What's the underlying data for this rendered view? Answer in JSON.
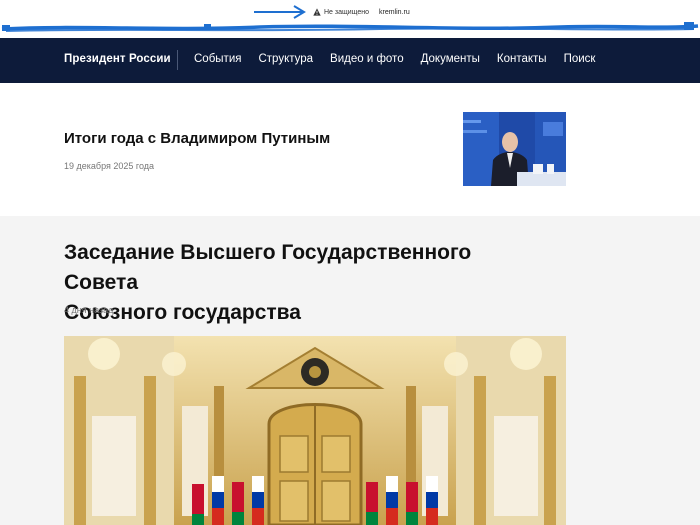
{
  "browser": {
    "security_label": "Не защищено",
    "url": "kremlin.ru"
  },
  "nav": {
    "brand": "Президент России",
    "links": [
      "События",
      "Структура",
      "Видео и фото",
      "Документы",
      "Контакты",
      "Поиск"
    ]
  },
  "featured": {
    "title": "Итоги года с Владимиром Путиным",
    "date": "19 декабря 2025 года"
  },
  "article": {
    "title_line1": "Заседание Высшего Государственного Совета",
    "title_line2": "Союзного государства",
    "date": "4 дня назад"
  },
  "colors": {
    "nav_bg": "#0d1b3a",
    "annotation": "#1e6fd0",
    "article_bg": "#f4f4f4"
  },
  "icons": {
    "security": "warning-triangle-icon",
    "annotation": "arrow-right-icon"
  }
}
